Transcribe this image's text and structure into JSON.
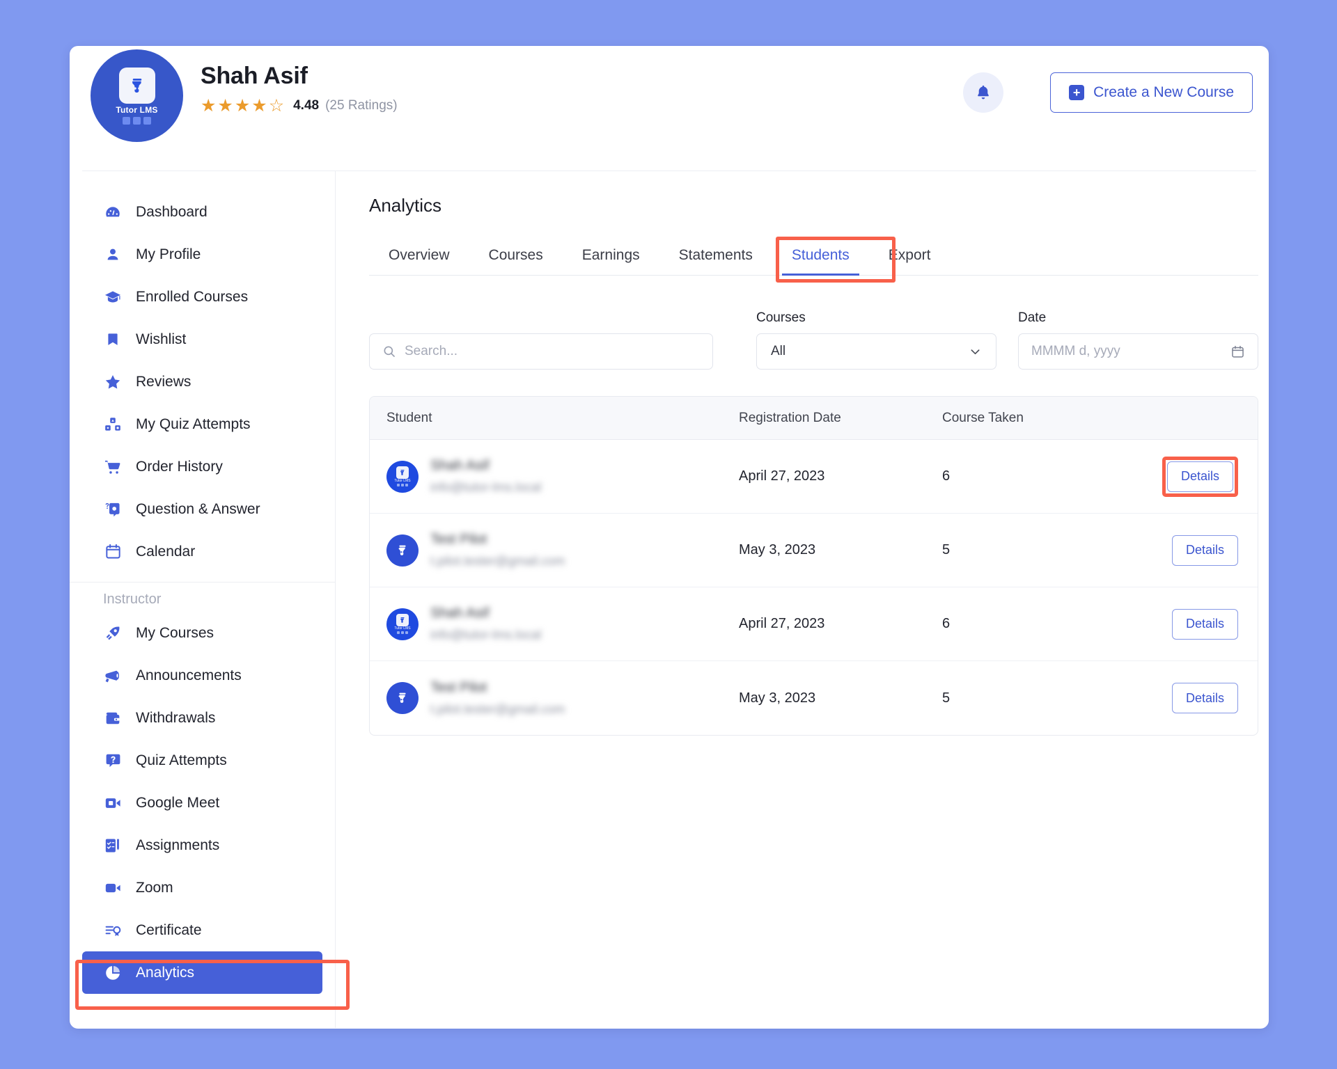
{
  "profile": {
    "name": "Shah Asif",
    "rating_value": "4.48",
    "rating_count": "(25 Ratings)",
    "stars_filled": 4,
    "stars_total": 5,
    "avatar_brand": "Tutor LMS"
  },
  "header": {
    "bell_icon": "bell-icon",
    "create_button": "Create a New Course",
    "plus_icon": "plus-icon"
  },
  "sidebar": {
    "items": [
      {
        "label": "Dashboard",
        "icon": "dashboard-gauge-icon"
      },
      {
        "label": "My Profile",
        "icon": "user-icon"
      },
      {
        "label": "Enrolled Courses",
        "icon": "graduation-cap-icon"
      },
      {
        "label": "Wishlist",
        "icon": "bookmark-icon"
      },
      {
        "label": "Reviews",
        "icon": "star-icon"
      },
      {
        "label": "My Quiz Attempts",
        "icon": "quiz-blocks-icon"
      },
      {
        "label": "Order History",
        "icon": "shopping-cart-icon"
      },
      {
        "label": "Question & Answer",
        "icon": "question-answer-icon"
      },
      {
        "label": "Calendar",
        "icon": "calendar-icon"
      }
    ],
    "group_label": "Instructor",
    "instructor_items": [
      {
        "label": "My Courses",
        "icon": "rocket-icon"
      },
      {
        "label": "Announcements",
        "icon": "megaphone-icon"
      },
      {
        "label": "Withdrawals",
        "icon": "wallet-icon"
      },
      {
        "label": "Quiz Attempts",
        "icon": "question-bubble-icon"
      },
      {
        "label": "Google Meet",
        "icon": "video-camera-icon"
      },
      {
        "label": "Assignments",
        "icon": "checklist-icon"
      },
      {
        "label": "Zoom",
        "icon": "video-icon"
      },
      {
        "label": "Certificate",
        "icon": "certificate-icon"
      },
      {
        "label": "Analytics",
        "icon": "pie-chart-icon",
        "active": true
      }
    ]
  },
  "main": {
    "title": "Analytics",
    "tabs": [
      {
        "label": "Overview",
        "active": false
      },
      {
        "label": "Courses",
        "active": false
      },
      {
        "label": "Earnings",
        "active": false
      },
      {
        "label": "Statements",
        "active": false
      },
      {
        "label": "Students",
        "active": true
      },
      {
        "label": "Export",
        "active": false
      }
    ],
    "filters": {
      "search_placeholder": "Search...",
      "search_value": "",
      "search_icon": "search-icon",
      "courses_label": "Courses",
      "courses_value": "All",
      "courses_chevron": "chevron-down-icon",
      "date_label": "Date",
      "date_placeholder": "MMMM d, yyyy",
      "date_icon": "calendar-icon"
    },
    "table": {
      "columns": [
        "Student",
        "Registration Date",
        "Course Taken",
        ""
      ],
      "rows": [
        {
          "name": "Shah Asif",
          "email": "info@tutor-lms.local",
          "date": "April 27, 2023",
          "count": "6",
          "action": "Details",
          "avatar": "tutor-lms-avatar",
          "highlighted": true
        },
        {
          "name": "Test Pilot",
          "email": "t.pilot.tester@gmail.com",
          "date": "May 3, 2023",
          "count": "5",
          "action": "Details",
          "avatar": "tutor-avatar",
          "highlighted": false
        },
        {
          "name": "Shah Asif",
          "email": "info@tutor-lms.local",
          "date": "April 27, 2023",
          "count": "6",
          "action": "Details",
          "avatar": "tutor-lms-avatar",
          "highlighted": false
        },
        {
          "name": "Test Pilot",
          "email": "t.pilot.tester@gmail.com",
          "date": "May 3, 2023",
          "count": "5",
          "action": "Details",
          "avatar": "tutor-avatar",
          "highlighted": false
        }
      ]
    }
  },
  "colors": {
    "page_background": "#8099f0",
    "brand_blue": "#4660d8",
    "highlight_red": "#f8604a",
    "star_gold": "#eb9b2c"
  }
}
